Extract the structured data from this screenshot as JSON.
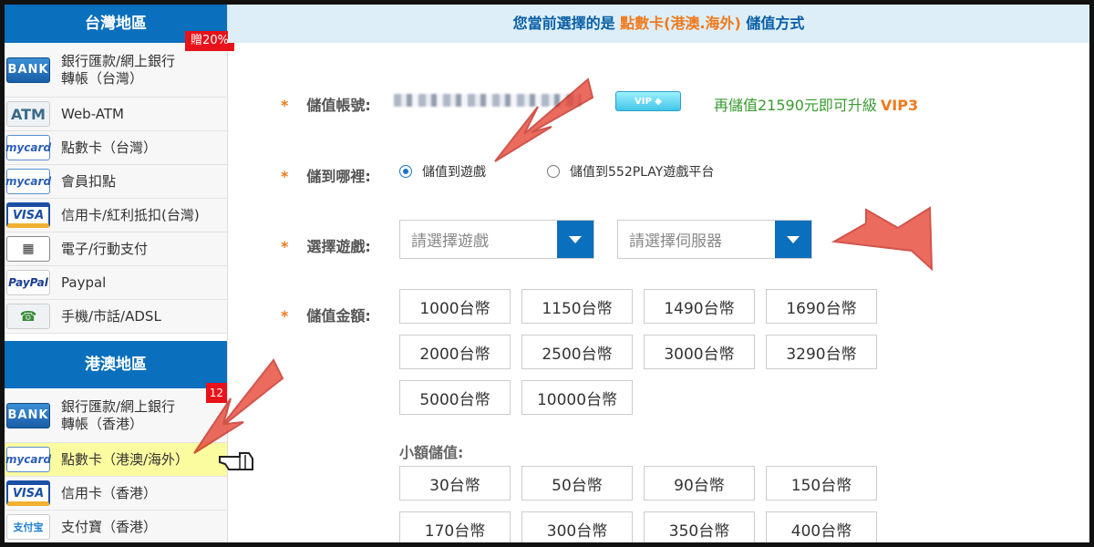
{
  "sidebar": {
    "taiwan_header": "台灣地區",
    "taiwan_items": [
      {
        "label_line1": "銀行匯款/網上銀行",
        "label_line2": "轉帳（台灣）",
        "logo": "BANK",
        "icon": "bank-icon",
        "ribbon": "贈20%"
      },
      {
        "label_line1": "Web-ATM",
        "label_line2": "",
        "logo": "ATM",
        "icon": "webatm-icon",
        "ribbon": ""
      },
      {
        "label_line1": "點數卡（台灣）",
        "label_line2": "",
        "logo": "mycard",
        "icon": "mycard-icon",
        "ribbon": ""
      },
      {
        "label_line1": "會員扣點",
        "label_line2": "",
        "logo": "mycard",
        "icon": "mycard-icon",
        "ribbon": ""
      },
      {
        "label_line1": "信用卡/紅利抵扣(台灣)",
        "label_line2": "",
        "logo": "VISA",
        "icon": "visa-icon",
        "ribbon": ""
      },
      {
        "label_line1": "電子/行動支付",
        "label_line2": "",
        "logo": "▦",
        "icon": "mobile-pay-icon",
        "ribbon": ""
      },
      {
        "label_line1": "Paypal",
        "label_line2": "",
        "logo": "PayPal",
        "icon": "paypal-icon",
        "ribbon": ""
      },
      {
        "label_line1": "手機/市話/ADSL",
        "label_line2": "",
        "logo": "☎",
        "icon": "phone-icon",
        "ribbon": ""
      }
    ],
    "hk_header": "港澳地區",
    "hk_items": [
      {
        "label_line1": "銀行匯款/網上銀行",
        "label_line2": "轉帳（香港）",
        "logo": "BANK",
        "icon": "bank-icon",
        "ribbon": "12"
      },
      {
        "label_line1": "點數卡（港澳/海外）",
        "label_line2": "",
        "logo": "mycard",
        "icon": "mycard-icon",
        "ribbon": ""
      },
      {
        "label_line1": "信用卡（香港）",
        "label_line2": "",
        "logo": "VISA",
        "icon": "visa-icon",
        "ribbon": ""
      },
      {
        "label_line1": "支付寶（香港）",
        "label_line2": "",
        "logo": "支付宝",
        "icon": "alipay-icon",
        "ribbon": ""
      }
    ]
  },
  "main": {
    "title_prefix": "您當前選擇的是 ",
    "title_highlight": "點數卡(港澳.海外)",
    "title_suffix": " 儲值方式",
    "account_label": "儲值帳號:",
    "vip_badge": "VIP ◆",
    "upgrade_text": "再儲值21590元即可升級",
    "upgrade_vip": "VIP3",
    "destination_label": "儲到哪裡:",
    "radio_game": "儲值到遊戲",
    "radio_platform": "儲值到552PLAY遊戲平台",
    "game_label": "選擇遊戲:",
    "game_placeholder": "請選擇遊戲",
    "server_placeholder": "請選擇伺服器",
    "amount_label": "儲值金額:",
    "amounts": [
      "1000台幣",
      "1150台幣",
      "1490台幣",
      "1690台幣",
      "2000台幣",
      "2500台幣",
      "3000台幣",
      "3290台幣",
      "5000台幣",
      "10000台幣"
    ],
    "small_label": "小額儲值:",
    "small_amounts": [
      "30台幣",
      "50台幣",
      "90台幣",
      "150台幣",
      "170台幣",
      "300台幣",
      "350台幣",
      "400台幣"
    ],
    "star": "*"
  },
  "colors": {
    "brand_blue": "#0a6fbd",
    "accent_orange": "#f07a1c",
    "upgrade_green": "#3a9a30",
    "ribbon_red": "#e8121a",
    "active_yellow": "#fbfba0"
  }
}
